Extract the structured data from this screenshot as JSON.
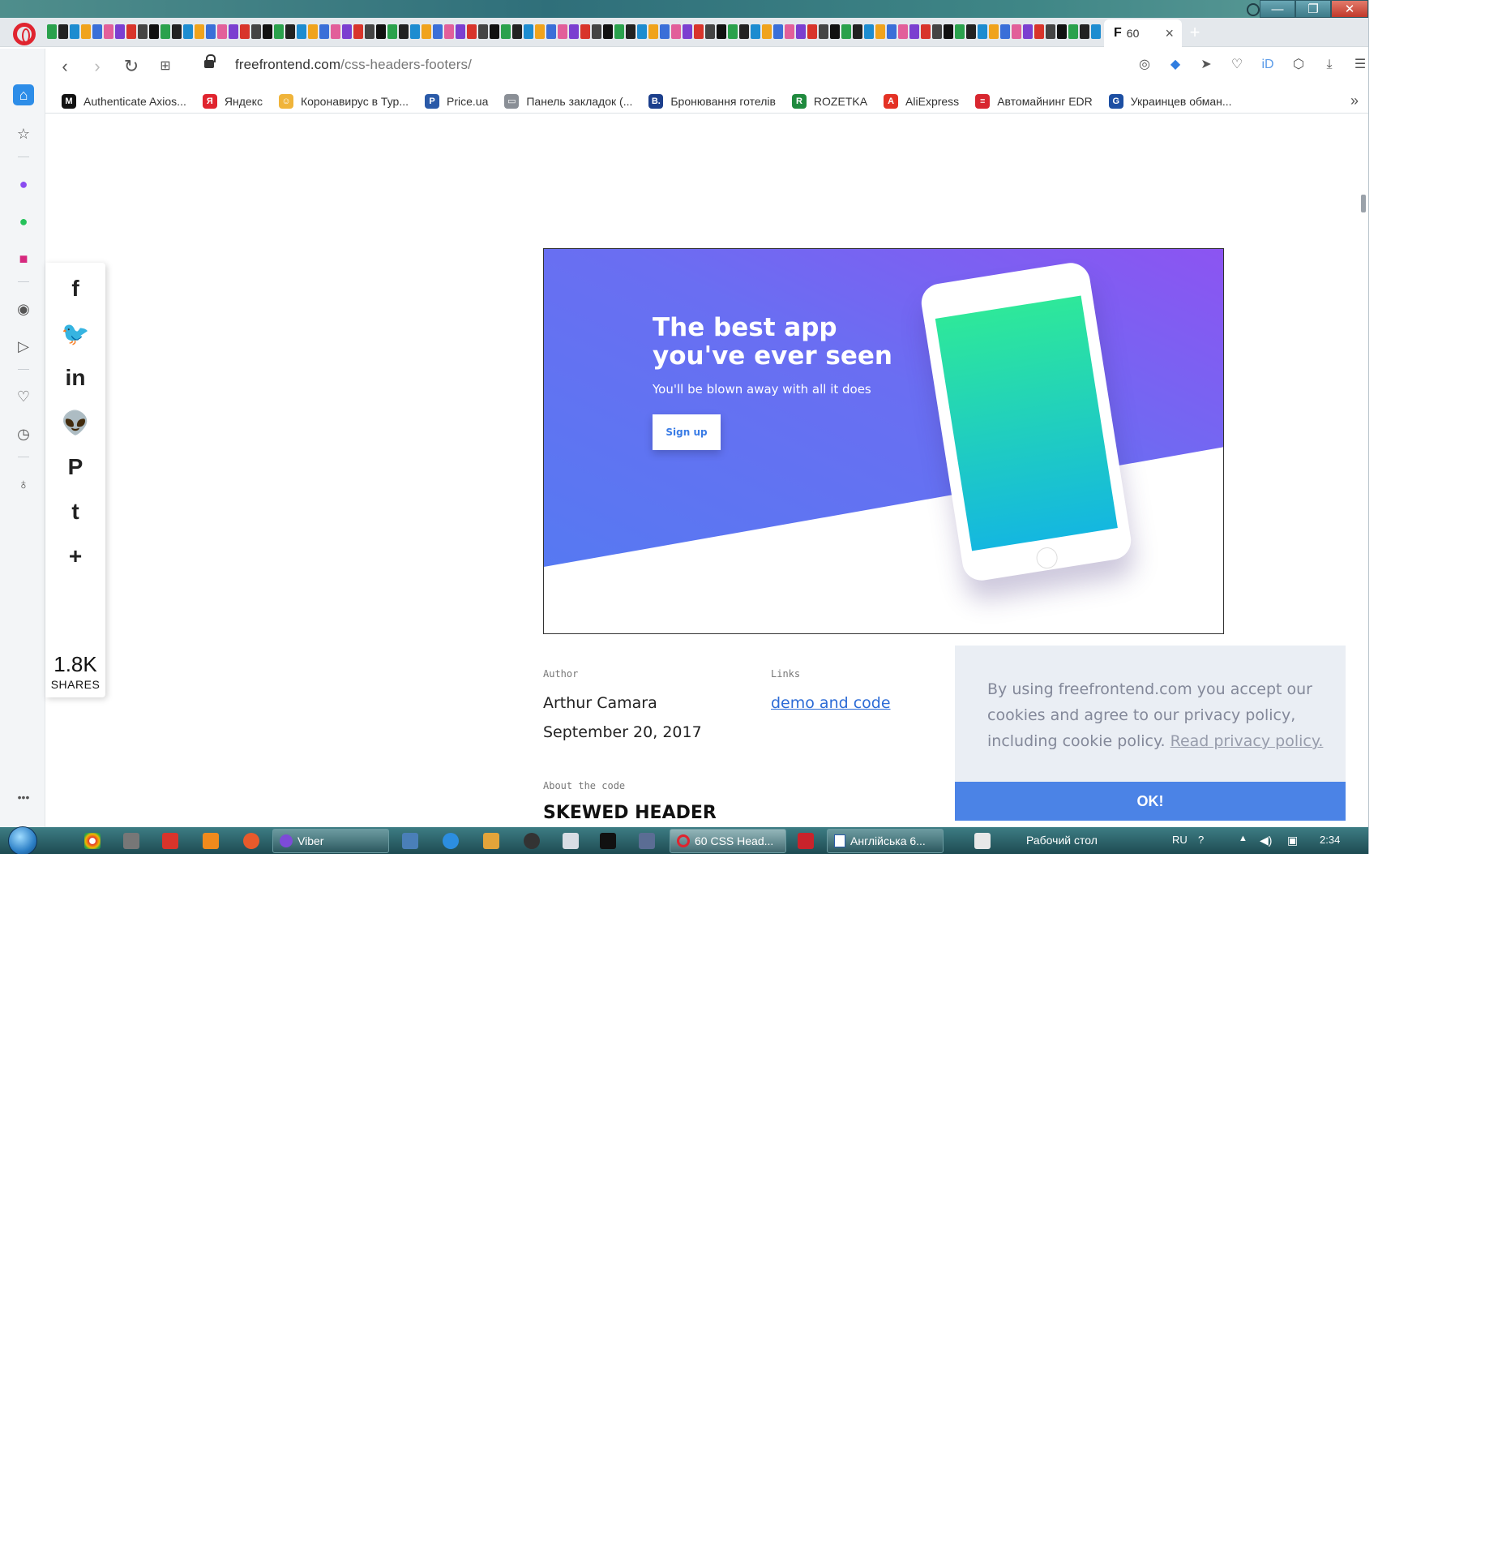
{
  "browser": {
    "active_tab_label": "60",
    "active_tab_favicon": "F",
    "url_domain": "freefrontend.com",
    "url_path": "/css-headers-footers/",
    "new_tab": "+",
    "close_tab": "×"
  },
  "window_controls": {
    "minimize": "—",
    "maximize": "❐",
    "close": "✕"
  },
  "bookmarks": [
    {
      "label": "Authenticate Axios...",
      "icon": "M",
      "color": "#111111"
    },
    {
      "label": "Яндекс",
      "icon": "Я",
      "color": "#e0242f"
    },
    {
      "label": "Коронавирус в Тур...",
      "icon": "☺",
      "color": "#f0b43a"
    },
    {
      "label": "Price.ua",
      "icon": "P",
      "color": "#2a5aa8"
    },
    {
      "label": "Панель закладок (...",
      "icon": "▭",
      "color": "#8a8f96"
    },
    {
      "label": "Бронювання готелів",
      "icon": "B.",
      "color": "#1c3f8c"
    },
    {
      "label": "ROZETKA",
      "icon": "R",
      "color": "#1f8a3e"
    },
    {
      "label": "AliExpress",
      "icon": "A",
      "color": "#e43225"
    },
    {
      "label": "Автомайнинг EDR",
      "icon": "≡",
      "color": "#d8262f"
    },
    {
      "label": "Украинцев обман...",
      "icon": "G",
      "color": "#1d4fa3"
    }
  ],
  "bookmarks_more": "»",
  "share": {
    "count": "1.8K",
    "label": "SHARES",
    "icons": [
      "facebook-icon",
      "twitter-icon",
      "linkedin-icon",
      "reddit-icon",
      "pinterest-icon",
      "tumblr-icon",
      "plus-icon"
    ],
    "glyphs": [
      "f",
      "🐦",
      "in",
      "👽",
      "P",
      "t",
      "+"
    ]
  },
  "hero": {
    "title": "The best app you've ever seen",
    "subtitle": "You'll be blown away with all it does",
    "button": "Sign up"
  },
  "meta": {
    "author_label": "Author",
    "author": "Arthur Camara",
    "date": "September 20, 2017",
    "links_label": "Links",
    "link_text": "demo and code",
    "about_label": "About the code",
    "code_title": "SKEWED HEADER"
  },
  "cookie": {
    "text": "By using freefrontend.com you accept our cookies and agree to our privacy policy, including cookie policy.",
    "link": "Read privacy policy.",
    "ok": "OK!"
  },
  "taskbar": {
    "viber": "Viber",
    "opera": "60 CSS Head...",
    "word": "Англійська 6...",
    "desktop": "Рабочий стол",
    "lang": "RU",
    "time": "2:34"
  },
  "colors": {
    "accent": "#4b83e6",
    "hero_gradient_start": "#5b6ff0",
    "hero_gradient_end": "#8a55f0",
    "opera_red": "#e0242f"
  }
}
